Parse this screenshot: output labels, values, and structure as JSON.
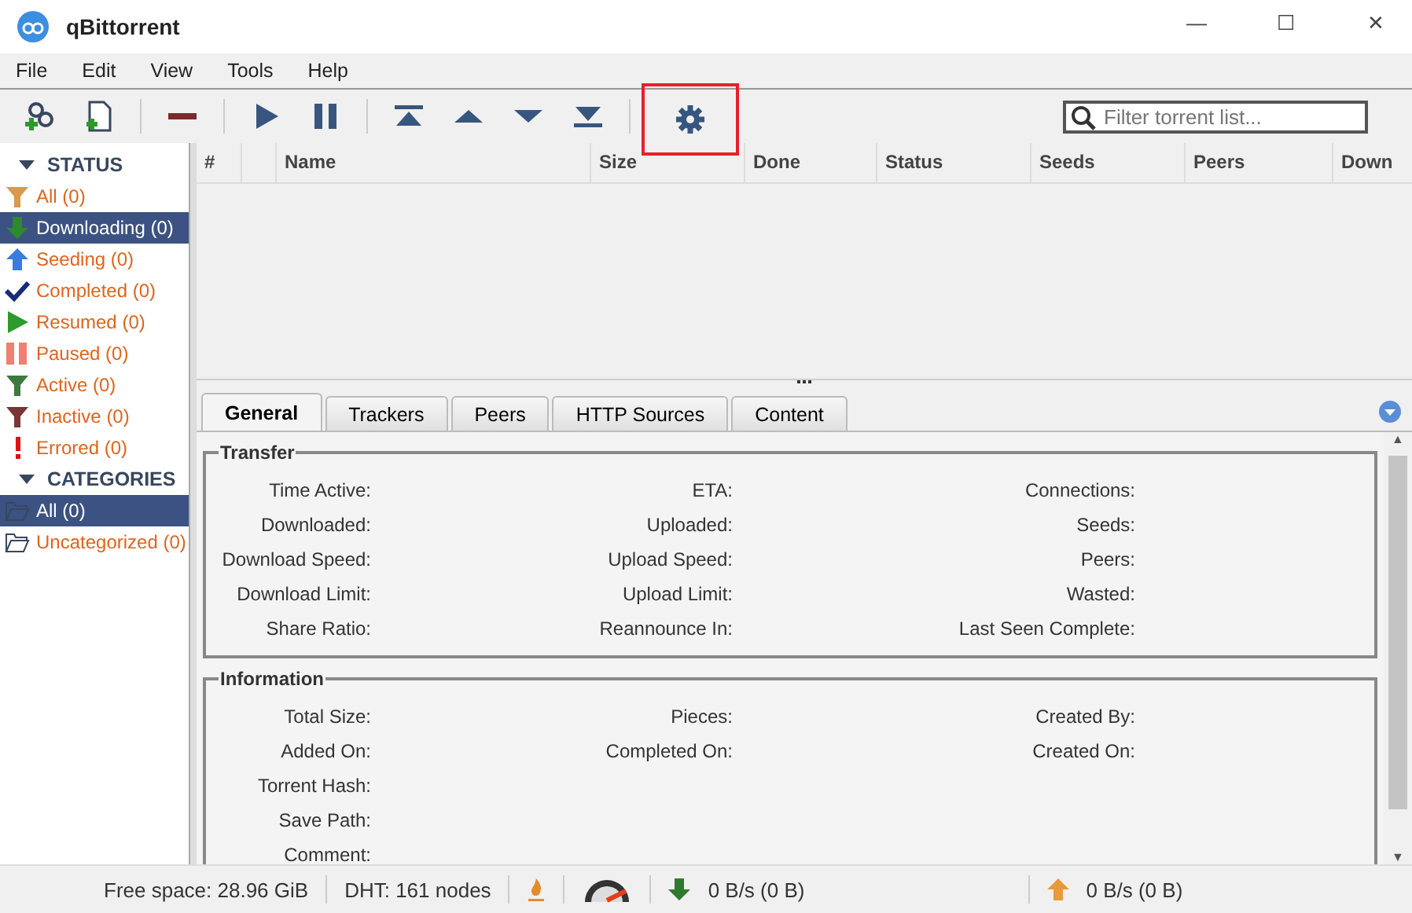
{
  "window": {
    "title": "qBittorrent",
    "controls": [
      "—",
      "☐",
      "✕"
    ]
  },
  "menu": [
    "File",
    "Edit",
    "View",
    "Tools",
    "Help"
  ],
  "toolbar": [
    {
      "kind": "add-link",
      "highlighted": false
    },
    {
      "kind": "add-file",
      "highlighted": false
    },
    {
      "kind": "sep"
    },
    {
      "kind": "remove",
      "highlighted": false
    },
    {
      "kind": "sep"
    },
    {
      "kind": "resume",
      "highlighted": false
    },
    {
      "kind": "pause",
      "highlighted": false
    },
    {
      "kind": "sep"
    },
    {
      "kind": "top",
      "highlighted": false
    },
    {
      "kind": "up",
      "highlighted": false
    },
    {
      "kind": "down",
      "highlighted": false
    },
    {
      "kind": "bottom",
      "highlighted": false
    },
    {
      "kind": "sep"
    },
    {
      "kind": "options",
      "highlighted": true
    }
  ],
  "search": {
    "placeholder": "Filter torrent list..."
  },
  "sidebar": {
    "sections": [
      {
        "title": "STATUS",
        "items": [
          {
            "label": "All (0)",
            "kind": "all",
            "selected": false
          },
          {
            "label": "Downloading (0)",
            "kind": "downloading",
            "selected": true
          },
          {
            "label": "Seeding (0)",
            "kind": "seeding",
            "selected": false
          },
          {
            "label": "Completed (0)",
            "kind": "completed",
            "selected": false
          },
          {
            "label": "Resumed (0)",
            "kind": "resumed",
            "selected": false
          },
          {
            "label": "Paused (0)",
            "kind": "paused",
            "selected": false
          },
          {
            "label": "Active (0)",
            "kind": "active",
            "selected": false
          },
          {
            "label": "Inactive (0)",
            "kind": "inactive",
            "selected": false
          },
          {
            "label": "Errored (0)",
            "kind": "errored",
            "selected": false
          }
        ]
      },
      {
        "title": "CATEGORIES",
        "items": [
          {
            "label": "All (0)",
            "kind": "folder",
            "selected": true
          },
          {
            "label": "Uncategorized (0)",
            "kind": "folder",
            "selected": false
          }
        ]
      }
    ]
  },
  "table": {
    "columns": [
      "#",
      "",
      "Name",
      "Size",
      "Done",
      "Status",
      "Seeds",
      "Peers",
      "Down"
    ]
  },
  "tabs": [
    {
      "label": "General",
      "selected": true
    },
    {
      "label": "Trackers",
      "selected": false
    },
    {
      "label": "Peers",
      "selected": false
    },
    {
      "label": "HTTP Sources",
      "selected": false
    },
    {
      "label": "Content",
      "selected": false
    }
  ],
  "groups": [
    {
      "title": "Transfer",
      "rows": [
        [
          "Time Active:",
          "ETA:",
          "Connections:"
        ],
        [
          "Downloaded:",
          "Uploaded:",
          "Seeds:"
        ],
        [
          "Download Speed:",
          "Upload Speed:",
          "Peers:"
        ],
        [
          "Download Limit:",
          "Upload Limit:",
          "Wasted:"
        ],
        [
          "Share Ratio:",
          "Reannounce In:",
          "Last Seen Complete:"
        ]
      ]
    },
    {
      "title": "Information",
      "rows": [
        [
          "Total Size:",
          "Pieces:",
          "Created By:"
        ],
        [
          "Added On:",
          "Completed On:",
          "Created On:"
        ],
        [
          "Torrent Hash:"
        ],
        [
          "Save Path:"
        ],
        [
          "Comment:"
        ]
      ]
    }
  ],
  "scrollbar": {
    "up": "▲",
    "down": "▼"
  },
  "status_bar": {
    "free_space": "Free space: 28.96 GiB",
    "dht": "DHT: 161 nodes",
    "download": "0 B/s (0 B)",
    "upload": "0 B/s (0 B)"
  }
}
